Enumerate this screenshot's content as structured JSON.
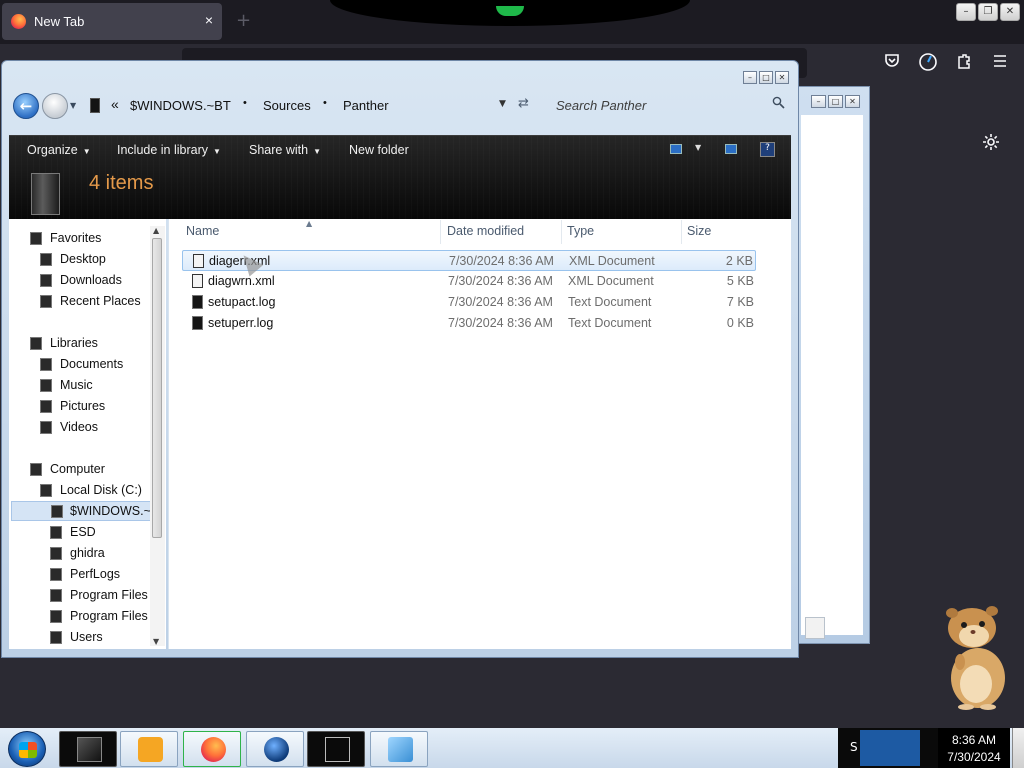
{
  "browser": {
    "tab_title": "New Tab",
    "tab_close": "×",
    "new_tab": "+",
    "window_controls": [
      "–",
      "❐",
      "✕"
    ]
  },
  "explorer": {
    "window_controls": [
      "–",
      "□",
      "✕"
    ],
    "breadcrumb_chevron": "«",
    "breadcrumbs": [
      "$WINDOWS.~BT",
      "Sources",
      "Panther"
    ],
    "breadcrumb_sep": "•",
    "search_placeholder": "Search Panther",
    "commands": {
      "organize": "Organize",
      "include_in_library": "Include in library",
      "share_with": "Share with",
      "new_folder": "New folder"
    },
    "item_count": "4 items",
    "columns": {
      "name": "Name",
      "date": "Date modified",
      "type": "Type",
      "size": "Size"
    },
    "files": [
      {
        "name": "diagerr.xml",
        "date": "7/30/2024 8:36 AM",
        "type": "XML Document",
        "size": "2 KB"
      },
      {
        "name": "diagwrn.xml",
        "date": "7/30/2024 8:36 AM",
        "type": "XML Document",
        "size": "5 KB"
      },
      {
        "name": "setupact.log",
        "date": "7/30/2024 8:36 AM",
        "type": "Text Document",
        "size": "7 KB"
      },
      {
        "name": "setuperr.log",
        "date": "7/30/2024 8:36 AM",
        "type": "Text Document",
        "size": "0 KB"
      }
    ],
    "nav": {
      "favorites": "Favorites",
      "desktop": "Desktop",
      "downloads": "Downloads",
      "recent_places": "Recent Places",
      "libraries": "Libraries",
      "documents": "Documents",
      "music": "Music",
      "pictures": "Pictures",
      "videos": "Videos",
      "computer": "Computer",
      "local_disk": "Local Disk (C:)",
      "windows_bt": "$WINDOWS.~B",
      "esd": "ESD",
      "ghidra": "ghidra",
      "perflogs": "PerfLogs",
      "program_files": "Program Files",
      "program_files_x86": "Program Files (",
      "users": "Users"
    }
  },
  "taskbar": {
    "time": "8:36 AM",
    "date": "7/30/2024",
    "tray_text": "S"
  },
  "colors": {
    "accent_orange": "#e59a4a",
    "selection_blue": "#dcebfb"
  }
}
